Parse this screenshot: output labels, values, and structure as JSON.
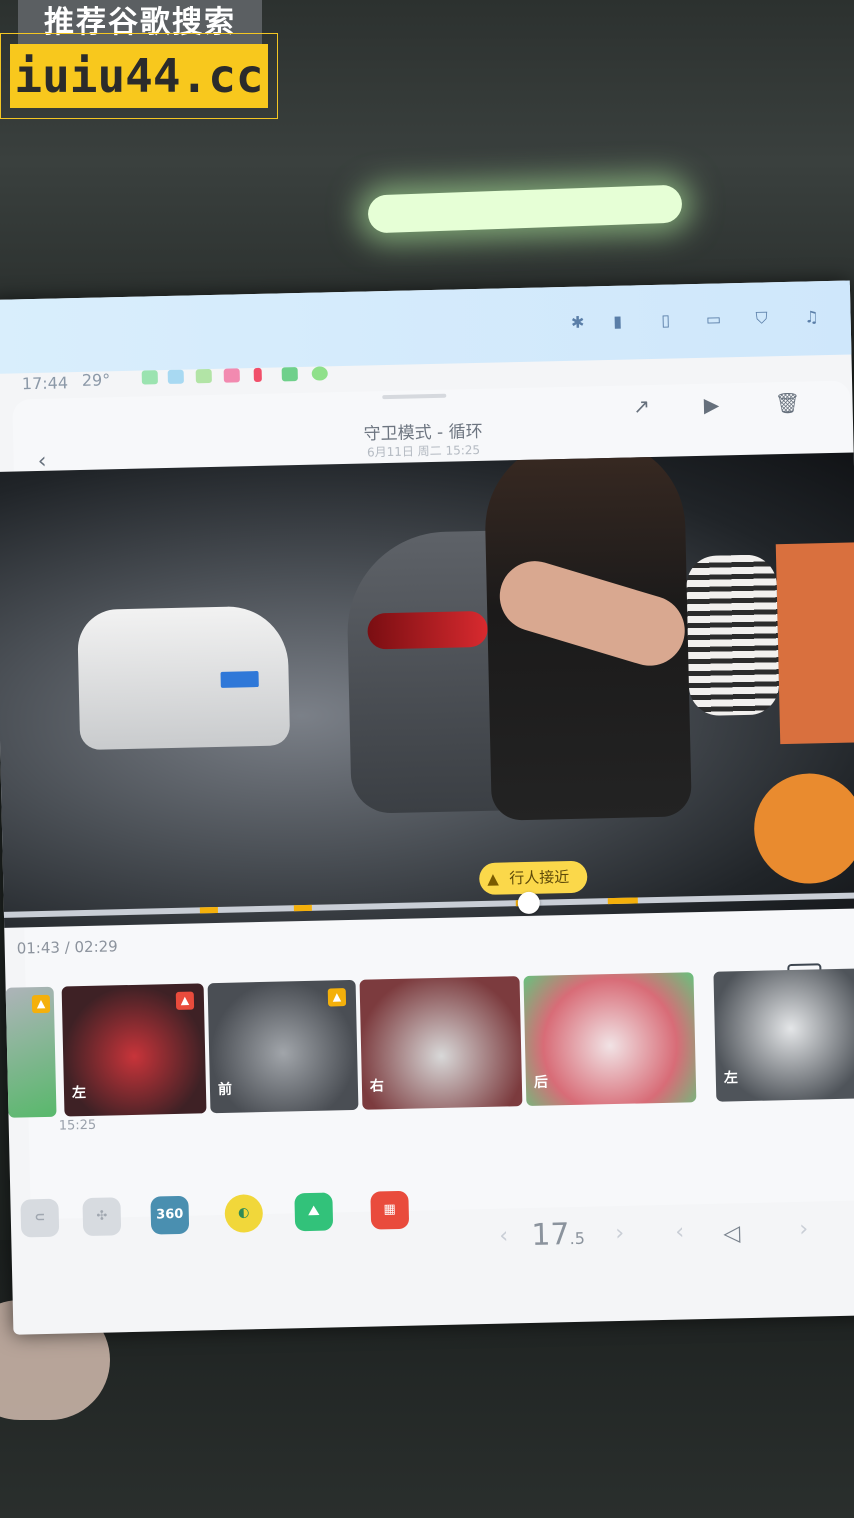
{
  "watermark": {
    "line1": "推荐谷歌搜索",
    "line2": "iuiu44.cc"
  },
  "status_bar": {
    "time": "17:44",
    "temperature": "29°"
  },
  "header": {
    "title": "守卫模式 - 循环",
    "subtitle": "6月11日 周二 15:25"
  },
  "video": {
    "alert_label": "行人接近",
    "current_time": "01:43 / 02:29"
  },
  "thumbnails": [
    {
      "label": "",
      "accent": "#58b86b"
    },
    {
      "label": "左",
      "accent": "#c8343a"
    },
    {
      "label": "前",
      "accent": "#6a6f75"
    },
    {
      "label": "右",
      "accent": "#b24245"
    },
    {
      "label": "后",
      "accent": "#d86c77"
    },
    {
      "label": "左",
      "accent": "#7b8189"
    }
  ],
  "thumbnail_time": "15:25",
  "dock": {
    "icon_360_label": "360",
    "temperature_value": "17",
    "temperature_decimal": ".5"
  },
  "colors": {
    "alert": "#fbd84a",
    "marker": "#f4b00b",
    "accent_red": "#e94b3c"
  }
}
